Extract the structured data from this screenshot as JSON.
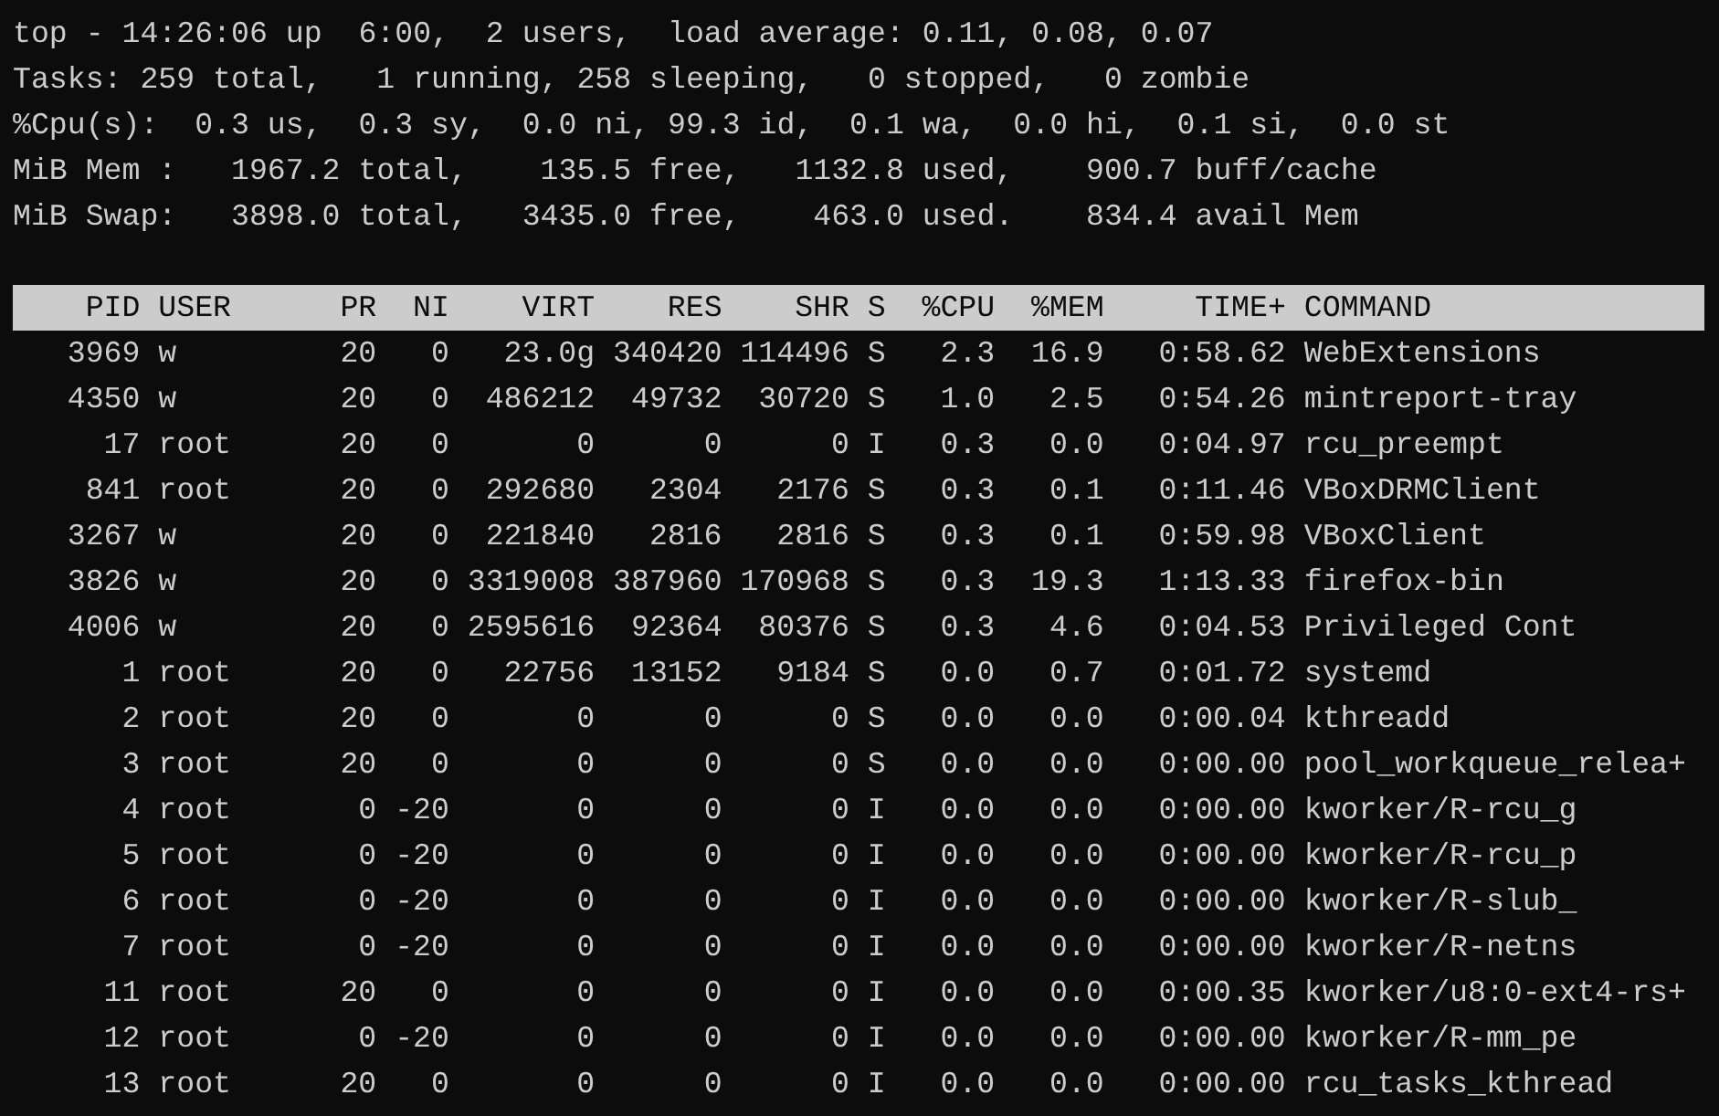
{
  "summary_lines": [
    "top - 14:26:06 up  6:00,  2 users,  load average: 0.11, 0.08, 0.07",
    "Tasks: 259 total,   1 running, 258 sleeping,   0 stopped,   0 zombie",
    "%Cpu(s):  0.3 us,  0.3 sy,  0.0 ni, 99.3 id,  0.1 wa,  0.0 hi,  0.1 si,  0.0 st",
    "MiB Mem :   1967.2 total,    135.5 free,   1132.8 used,    900.7 buff/cache",
    "MiB Swap:   3898.0 total,   3435.0 free,    463.0 used.    834.4 avail Mem"
  ],
  "table": {
    "columns": [
      "PID",
      "USER",
      "PR",
      "NI",
      "VIRT",
      "RES",
      "SHR",
      "S",
      "%CPU",
      "%MEM",
      "TIME+",
      "COMMAND"
    ],
    "rows": [
      [
        "3969",
        "w",
        "20",
        "0",
        "23.0g",
        "340420",
        "114496",
        "S",
        "2.3",
        "16.9",
        "0:58.62",
        "WebExtensions"
      ],
      [
        "4350",
        "w",
        "20",
        "0",
        "486212",
        "49732",
        "30720",
        "S",
        "1.0",
        "2.5",
        "0:54.26",
        "mintreport-tray"
      ],
      [
        "17",
        "root",
        "20",
        "0",
        "0",
        "0",
        "0",
        "I",
        "0.3",
        "0.0",
        "0:04.97",
        "rcu_preempt"
      ],
      [
        "841",
        "root",
        "20",
        "0",
        "292680",
        "2304",
        "2176",
        "S",
        "0.3",
        "0.1",
        "0:11.46",
        "VBoxDRMClient"
      ],
      [
        "3267",
        "w",
        "20",
        "0",
        "221840",
        "2816",
        "2816",
        "S",
        "0.3",
        "0.1",
        "0:59.98",
        "VBoxClient"
      ],
      [
        "3826",
        "w",
        "20",
        "0",
        "3319008",
        "387960",
        "170968",
        "S",
        "0.3",
        "19.3",
        "1:13.33",
        "firefox-bin"
      ],
      [
        "4006",
        "w",
        "20",
        "0",
        "2595616",
        "92364",
        "80376",
        "S",
        "0.3",
        "4.6",
        "0:04.53",
        "Privileged Cont"
      ],
      [
        "1",
        "root",
        "20",
        "0",
        "22756",
        "13152",
        "9184",
        "S",
        "0.0",
        "0.7",
        "0:01.72",
        "systemd"
      ],
      [
        "2",
        "root",
        "20",
        "0",
        "0",
        "0",
        "0",
        "S",
        "0.0",
        "0.0",
        "0:00.04",
        "kthreadd"
      ],
      [
        "3",
        "root",
        "20",
        "0",
        "0",
        "0",
        "0",
        "S",
        "0.0",
        "0.0",
        "0:00.00",
        "pool_workqueue_relea+"
      ],
      [
        "4",
        "root",
        "0",
        "-20",
        "0",
        "0",
        "0",
        "I",
        "0.0",
        "0.0",
        "0:00.00",
        "kworker/R-rcu_g"
      ],
      [
        "5",
        "root",
        "0",
        "-20",
        "0",
        "0",
        "0",
        "I",
        "0.0",
        "0.0",
        "0:00.00",
        "kworker/R-rcu_p"
      ],
      [
        "6",
        "root",
        "0",
        "-20",
        "0",
        "0",
        "0",
        "I",
        "0.0",
        "0.0",
        "0:00.00",
        "kworker/R-slub_"
      ],
      [
        "7",
        "root",
        "0",
        "-20",
        "0",
        "0",
        "0",
        "I",
        "0.0",
        "0.0",
        "0:00.00",
        "kworker/R-netns"
      ],
      [
        "11",
        "root",
        "20",
        "0",
        "0",
        "0",
        "0",
        "I",
        "0.0",
        "0.0",
        "0:00.35",
        "kworker/u8:0-ext4-rs+"
      ],
      [
        "12",
        "root",
        "0",
        "-20",
        "0",
        "0",
        "0",
        "I",
        "0.0",
        "0.0",
        "0:00.00",
        "kworker/R-mm_pe"
      ],
      [
        "13",
        "root",
        "20",
        "0",
        "0",
        "0",
        "0",
        "I",
        "0.0",
        "0.0",
        "0:00.00",
        "rcu_tasks_kthread"
      ]
    ]
  }
}
